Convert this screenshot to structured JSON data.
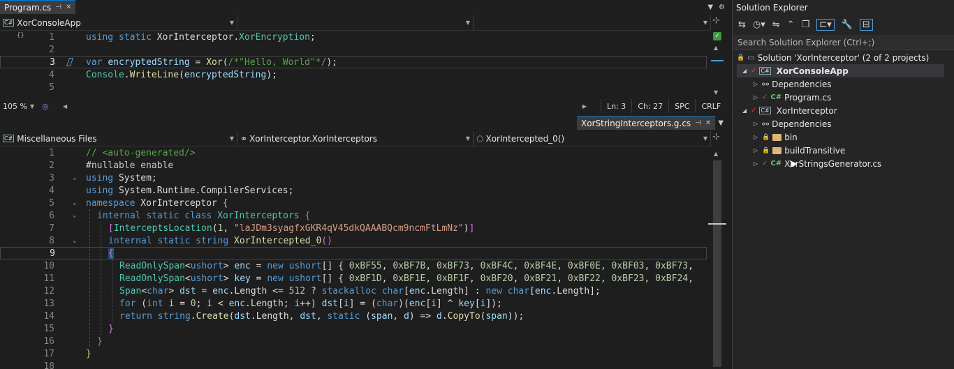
{
  "top_editor": {
    "tab": {
      "label": "Program.cs"
    },
    "nav": {
      "project": "XorConsoleApp",
      "member": "",
      "scope": ""
    },
    "lines": [
      {
        "n": "1",
        "text": "using static XorInterceptor.XorEncryption;"
      },
      {
        "n": "2",
        "text": ""
      },
      {
        "n": "3",
        "text": "var encryptedString = Xor(/*\"Hello, World\"*/);"
      },
      {
        "n": "4",
        "text": "Console.WriteLine(encryptedString);"
      },
      {
        "n": "5",
        "text": ""
      }
    ],
    "status": {
      "zoom": "105 %",
      "line": "Ln: 3",
      "col": "Ch: 27",
      "spacing": "SPC",
      "eol": "CRLF"
    }
  },
  "bottom_editor": {
    "tab": {
      "label": "XorStringInterceptors.g.cs"
    },
    "nav": {
      "project": "Miscellaneous Files",
      "class": "XorInterceptor.XorInterceptors",
      "member": "XorIntercepted_0()"
    },
    "lines": [
      {
        "n": "1",
        "text": "// <auto-generated/>"
      },
      {
        "n": "2",
        "text": "#nullable enable"
      },
      {
        "n": "3",
        "text": "using System;"
      },
      {
        "n": "4",
        "text": "using System.Runtime.CompilerServices;"
      },
      {
        "n": "5",
        "text": "namespace XorInterceptor {"
      },
      {
        "n": "6",
        "text": "  internal static class XorInterceptors {"
      },
      {
        "n": "7",
        "text": "    [InterceptsLocation(1, \"laJDm3syagfxGKR4qV45dkQAAABQcm9ncmFtLmNz\")]"
      },
      {
        "n": "8",
        "text": "    internal static string XorIntercepted_0()"
      },
      {
        "n": "9",
        "text": "    {"
      },
      {
        "n": "10",
        "text": "      ReadOnlySpan<ushort> enc = new ushort[] { 0xBF55, 0xBF7B, 0xBF73, 0xBF4C, 0xBF4E, 0xBF0E, 0xBF03, 0xBF73,"
      },
      {
        "n": "11",
        "text": "      ReadOnlySpan<ushort> key = new ushort[] { 0xBF1D, 0xBF1E, 0xBF1F, 0xBF20, 0xBF21, 0xBF22, 0xBF23, 0xBF24,"
      },
      {
        "n": "12",
        "text": "      Span<char> dst = enc.Length <= 512 ? stackalloc char[enc.Length] : new char[enc.Length];"
      },
      {
        "n": "13",
        "text": "      for (int i = 0; i < enc.Length; i++) dst[i] = (char)(enc[i] ^ key[i]);"
      },
      {
        "n": "14",
        "text": "      return string.Create(dst.Length, dst, static (span, d) => d.CopyTo(span));"
      },
      {
        "n": "15",
        "text": "    }"
      },
      {
        "n": "16",
        "text": "  }"
      },
      {
        "n": "17",
        "text": "}"
      },
      {
        "n": "18",
        "text": ""
      }
    ]
  },
  "solution_explorer": {
    "title": "Solution Explorer",
    "search_placeholder": "Search Solution Explorer (Ctrl+;)",
    "items": [
      {
        "label": "Solution 'XorInterceptor' (2 of 2 projects)"
      },
      {
        "label": "XorConsoleApp"
      },
      {
        "label": "Dependencies"
      },
      {
        "label": "Program.cs"
      },
      {
        "label": "XorInterceptor"
      },
      {
        "label": "Dependencies"
      },
      {
        "label": "bin"
      },
      {
        "label": "buildTransitive"
      },
      {
        "label": "XorStringsGenerator.cs"
      }
    ]
  },
  "colors": {
    "accent": "#0078d4",
    "keyword": "#569cd6",
    "type": "#4ec9b0",
    "string": "#d69d85",
    "comment": "#57a64a",
    "method": "#dcdcaa"
  }
}
